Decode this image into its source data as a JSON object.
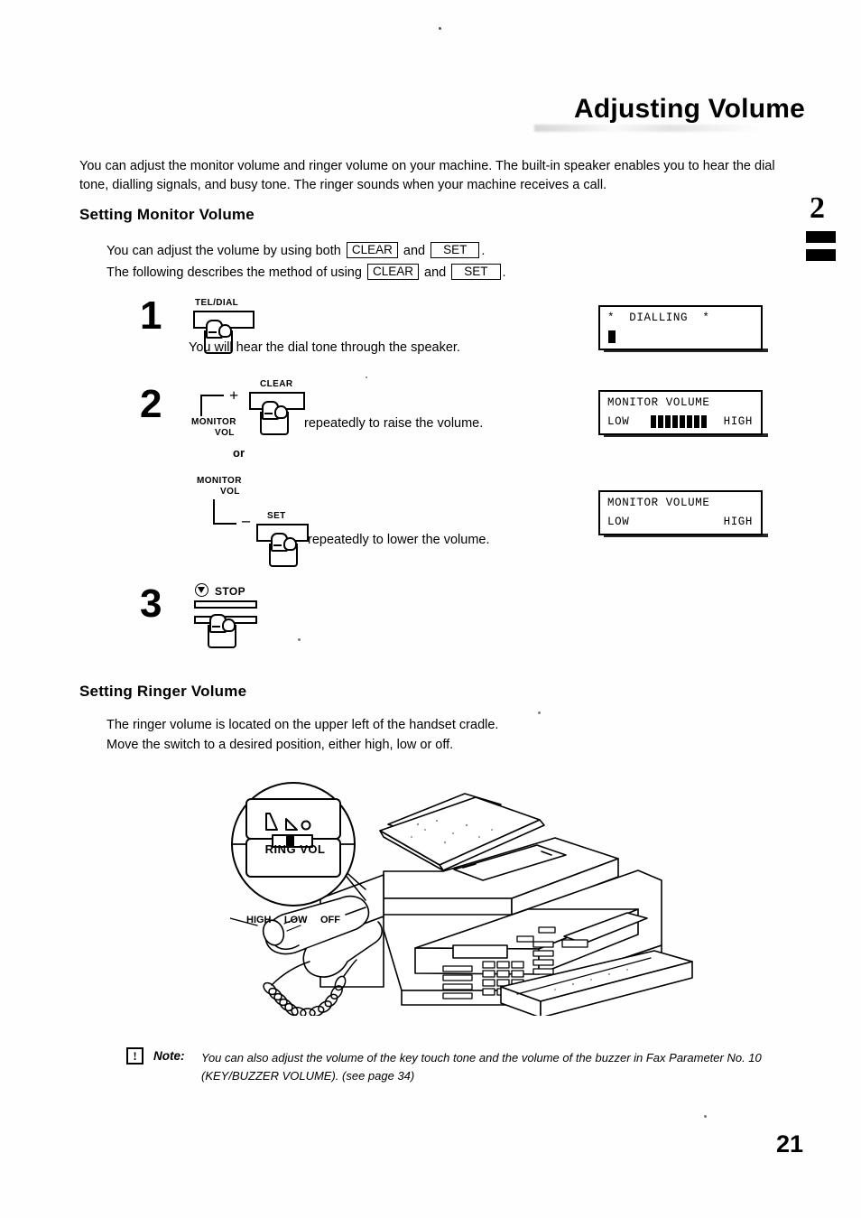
{
  "document": {
    "title": "Adjusting Volume",
    "page_number": "21",
    "chapter_tab_number": "2"
  },
  "intro": {
    "text": "You can adjust the monitor volume and ringer volume on your machine. The built-in speaker enables you to hear the dial tone, dialling signals, and busy tone. The ringer sounds when your machine receives a call."
  },
  "monitor_section": {
    "heading": "Setting Monitor Volume",
    "line1_before": "You can adjust the volume by using both",
    "line1_key1": "CLEAR",
    "line1_and": "and",
    "line1_key2": "SET",
    "line1_end": ".",
    "line2_before": "The following describes the method of using",
    "line2_key1": "CLEAR",
    "line2_and": "and",
    "line2_key2": "SET",
    "line2_end": "."
  },
  "steps": [
    {
      "number": "1",
      "button_label": "TEL/DIAL",
      "text": "You will hear the dial tone through the speaker."
    },
    {
      "number": "2",
      "bracket_label_line1": "MONITOR",
      "bracket_label_line2": "VOL",
      "plus_sign": "+",
      "button_label_plus": "CLEAR",
      "text_plus": "repeatedly to raise the volume.",
      "or_label": "or",
      "bracket_label2_line1": "MONITOR",
      "bracket_label2_line2": "VOL",
      "minus_sign": "–",
      "button_label_minus": "SET",
      "text_minus": "repeatedly to lower the volume."
    },
    {
      "number": "3",
      "button_label": "STOP",
      "icon": "stop-triangle-icon"
    }
  ],
  "displays": [
    {
      "name": "dialling-display",
      "line1": "*  DIALLING  *",
      "line2": "",
      "cursor": true,
      "bars": 0
    },
    {
      "name": "monitor-volume-high-display",
      "line1": "MONITOR VOLUME",
      "line2_left": "LOW",
      "line2_right": "HIGH",
      "bars": 8
    },
    {
      "name": "monitor-volume-low-display",
      "line1": "MONITOR VOLUME",
      "line2_left": "LOW",
      "line2_right": "HIGH",
      "bars": 0
    }
  ],
  "ringer_section": {
    "heading": "Setting Ringer Volume",
    "line1": "The ringer volume is located on the upper left of the handset cradle.",
    "line2": "Move the switch to a desired position, either high, low or off."
  },
  "callout": {
    "title": "RING VOL",
    "labels": "HIGH  LOW  OFF",
    "label_high": "HIGH",
    "label_low": "LOW",
    "label_off": "OFF"
  },
  "note": {
    "icon": "exclamation-icon",
    "icon_char": "!",
    "label": "Note:",
    "text": "You can also adjust the volume of the key touch tone and the volume of the buzzer in Fax Parameter No. 10 (KEY/BUZZER VOLUME). (see page 34)"
  },
  "colors": {
    "ink": "#000000",
    "paper": "#fefefe"
  }
}
